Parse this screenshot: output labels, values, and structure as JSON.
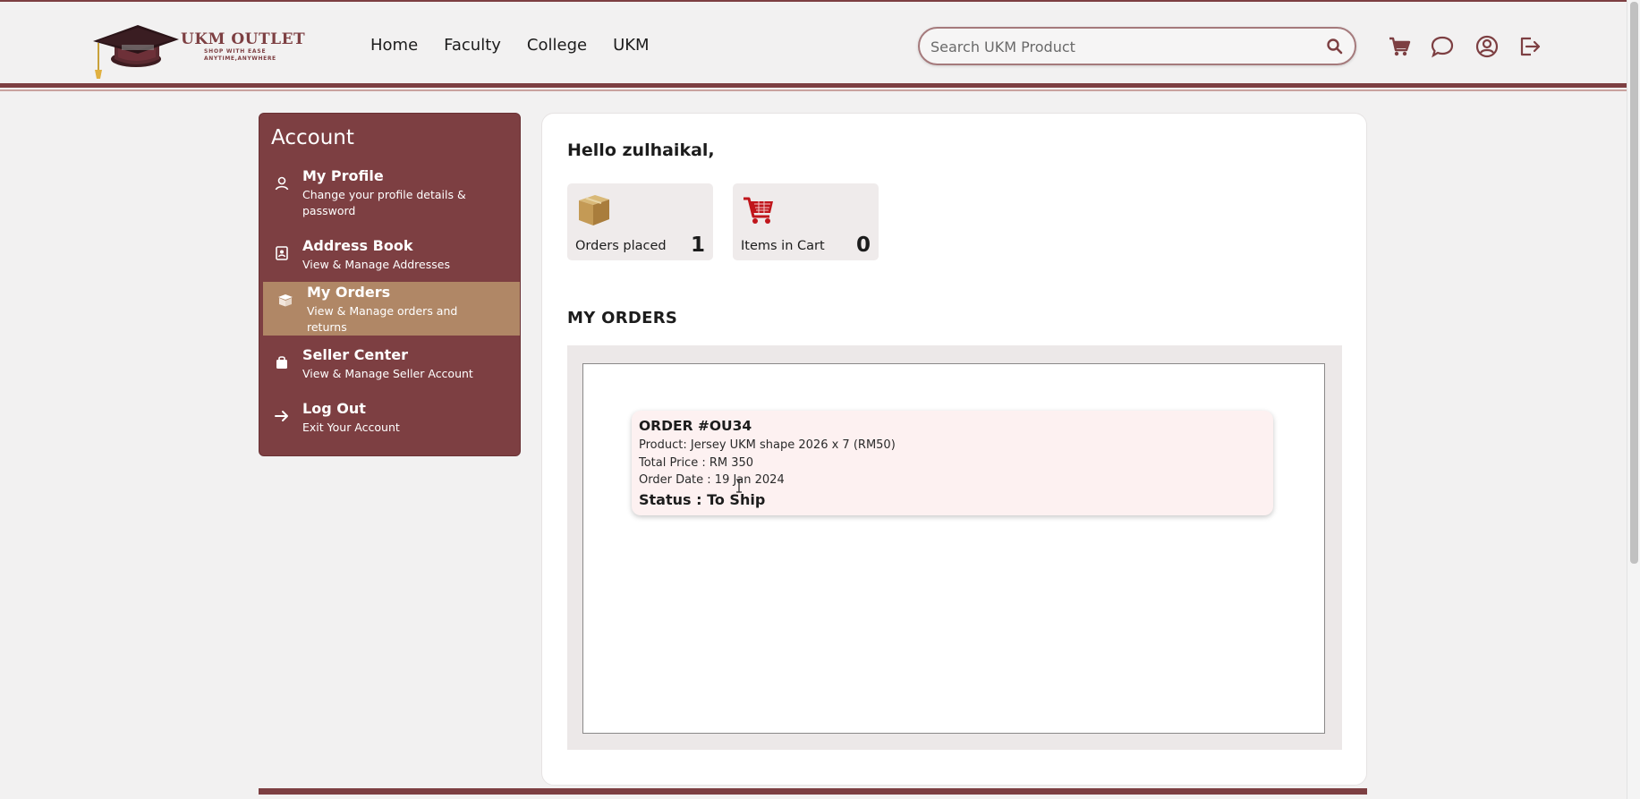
{
  "brand": {
    "name": "UKM OUTLET",
    "tagline_1": "SHOP WITH EASE",
    "tagline_2": "ANYTIME,ANYWHERE"
  },
  "nav": {
    "items": [
      {
        "label": "Home"
      },
      {
        "label": "Faculty"
      },
      {
        "label": "College"
      },
      {
        "label": "UKM"
      }
    ]
  },
  "search": {
    "placeholder": "Search UKM Product",
    "value": ""
  },
  "header_icons": [
    "cart-icon",
    "chat-icon",
    "user-account-icon",
    "logout-icon"
  ],
  "sidebar": {
    "title": "Account",
    "items": [
      {
        "label": "My Profile",
        "sub": "Change your profile details & password",
        "icon": "user-icon"
      },
      {
        "label": "Address Book",
        "sub": "View & Manage Addresses",
        "icon": "address-book-icon"
      },
      {
        "label": "My Orders",
        "sub": "View & Manage orders and returns",
        "icon": "box-icon",
        "active": true
      },
      {
        "label": "Seller Center",
        "sub": "View & Manage Seller Account",
        "icon": "shopping-bag-icon"
      },
      {
        "label": "Log Out",
        "sub": "Exit Your Account",
        "icon": "arrow-right-icon"
      }
    ]
  },
  "main": {
    "greeting": "Hello zulhaikal,",
    "stats": [
      {
        "label": "Orders placed",
        "value": "1",
        "icon": "package-icon"
      },
      {
        "label": "Items in Cart",
        "value": "0",
        "icon": "shopping-cart-icon"
      }
    ],
    "orders_title": "MY ORDERS",
    "orders": [
      {
        "id": "ORDER #OU34",
        "product": "Product: Jersey UKM shape 2026 x 7 (RM50)",
        "total": "Total Price : RM 350",
        "date": "Order Date : 19 Jan 2024",
        "status": "Status : To Ship"
      }
    ]
  },
  "colors": {
    "primary": "#7d3f42",
    "active_item": "#b08766",
    "background": "#f2f1f1",
    "order_card": "#fdf1f1"
  }
}
